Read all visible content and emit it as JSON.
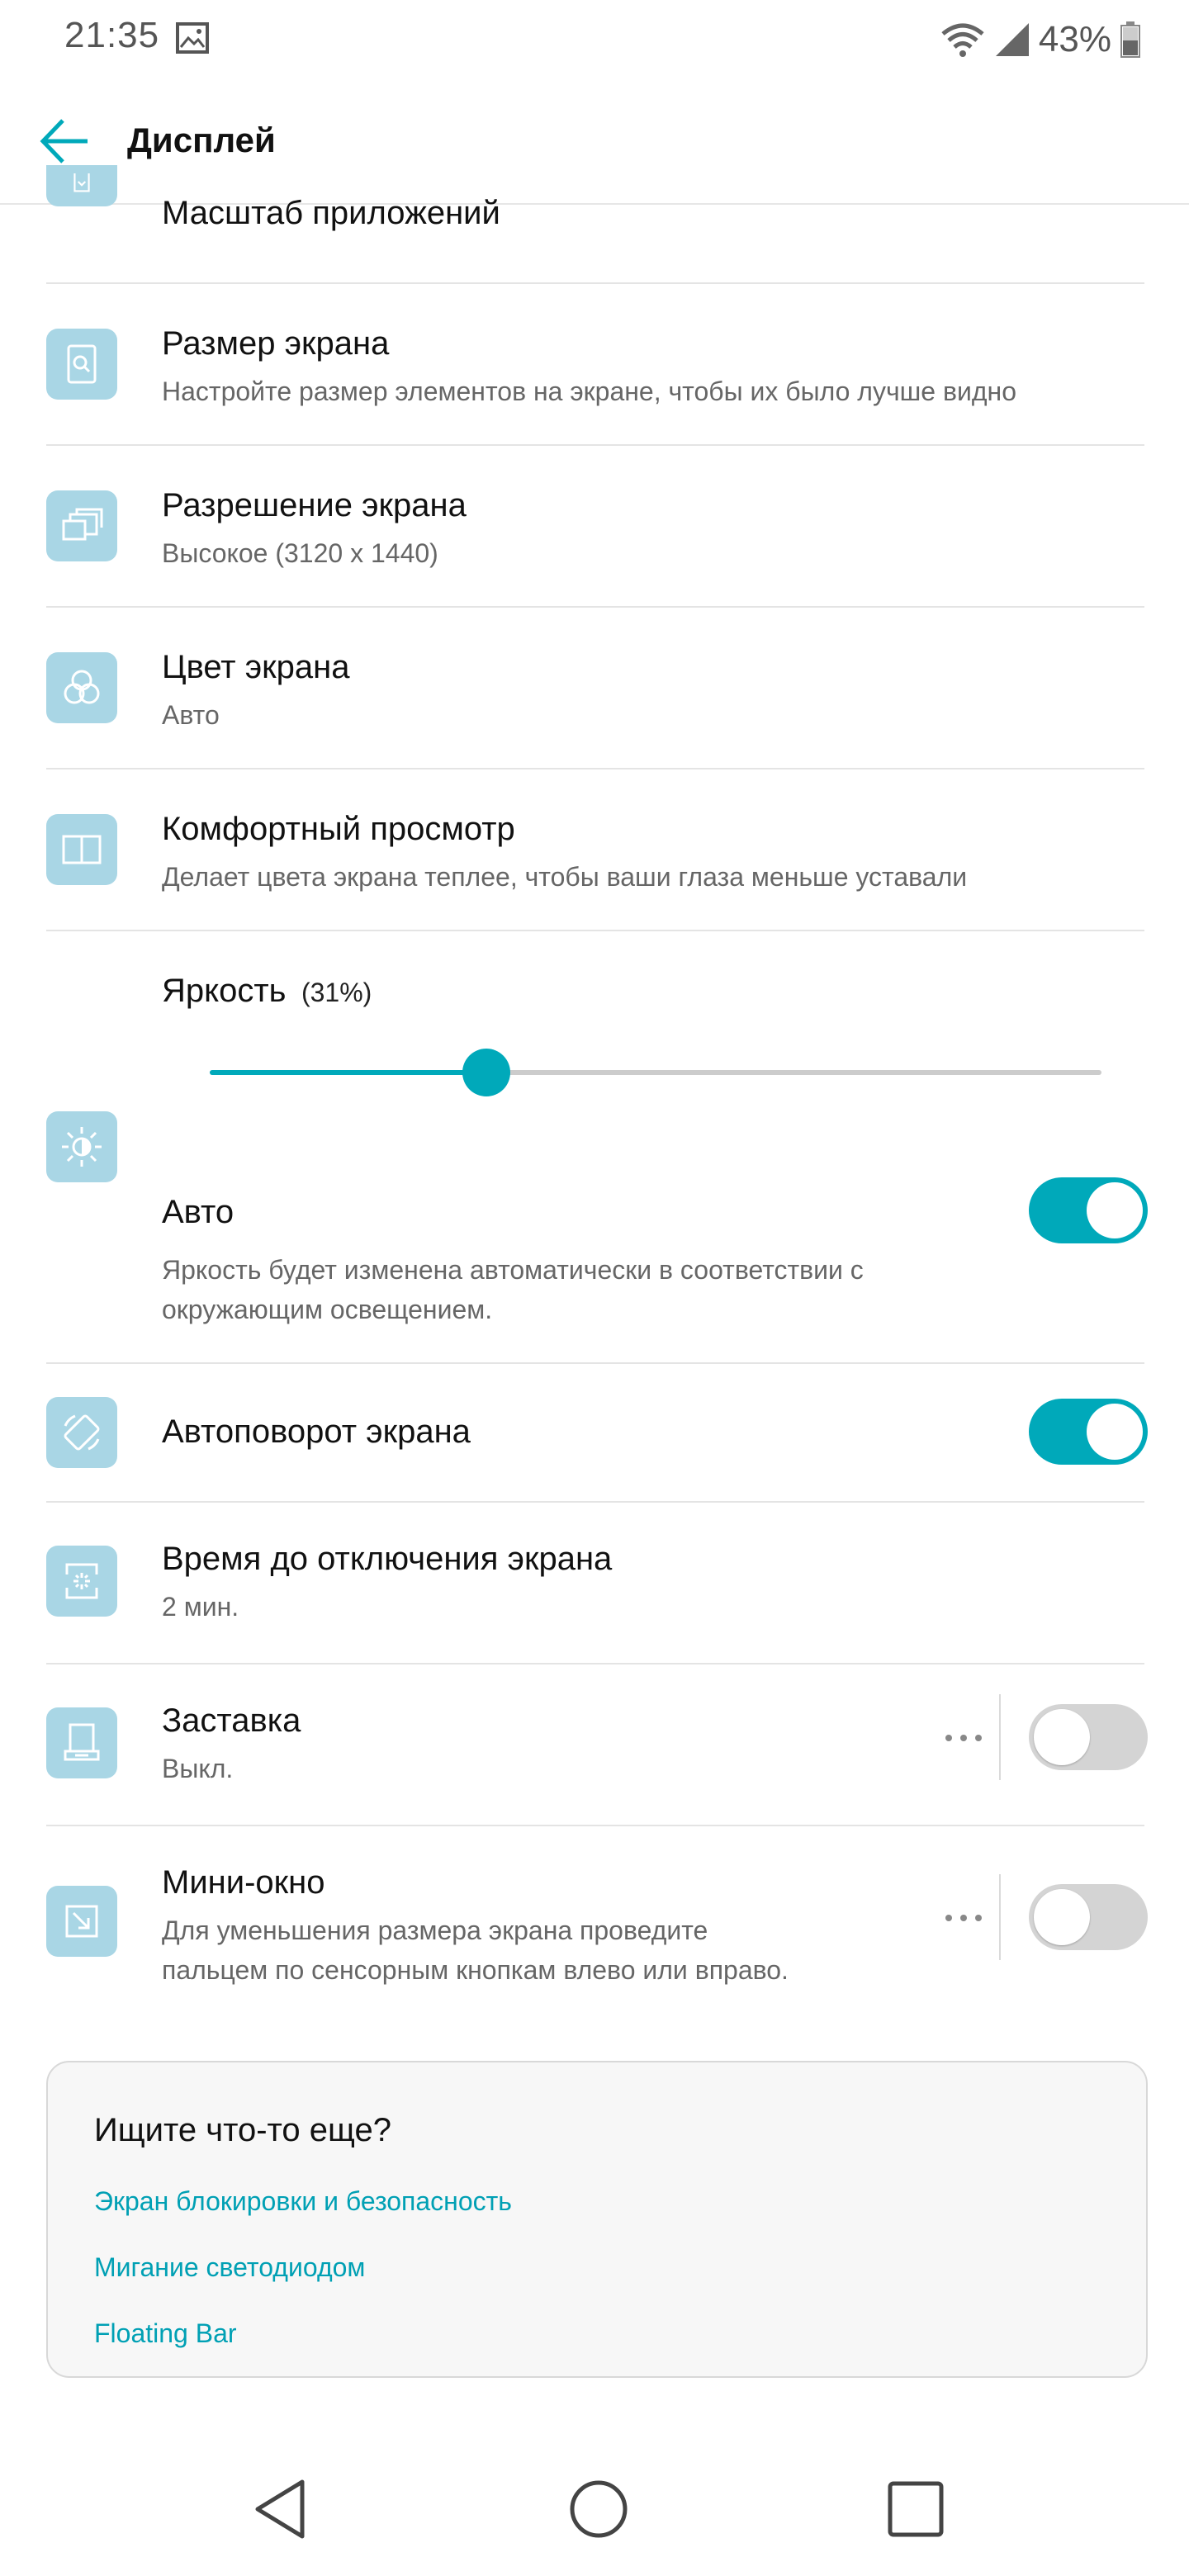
{
  "status_bar": {
    "time": "21:35",
    "battery": "43%"
  },
  "app_bar": {
    "title": "Дисплей"
  },
  "items": {
    "app_scale": {
      "title": "Масштаб приложений",
      "icon": "app-scale-icon"
    },
    "screen_size": {
      "title": "Размер экрана",
      "subtitle": "Настройте размер элементов на экране, чтобы их было лучше видно",
      "icon": "screen-size-icon"
    },
    "resolution": {
      "title": "Разрешение экрана",
      "subtitle": "Высокое (3120 x 1440)",
      "icon": "resolution-icon"
    },
    "color": {
      "title": "Цвет экрана",
      "subtitle": "Авто",
      "icon": "color-circles-icon"
    },
    "comfort": {
      "title": "Комфортный просмотр",
      "subtitle": "Делает цвета экрана теплее, чтобы ваши глаза меньше уставали",
      "icon": "book-icon"
    },
    "brightness": {
      "title": "Яркость",
      "value_label": "(31%)",
      "value": 0.31,
      "icon": "brightness-icon",
      "auto_title": "Авто",
      "auto_on": true,
      "auto_desc_1": "Яркость будет изменена автоматически в соответствии с",
      "auto_desc_2": "окружающим освещением."
    },
    "autorotate": {
      "title": "Автоповорот экрана",
      "on": true,
      "icon": "rotate-icon"
    },
    "timeout": {
      "title": "Время до отключения экрана",
      "subtitle": "2 мин.",
      "icon": "timeout-icon"
    },
    "screensaver": {
      "title": "Заставка",
      "subtitle": "Выкл.",
      "on": false,
      "icon": "screensaver-icon"
    },
    "mini_window": {
      "title": "Мини-окно",
      "subtitle_1": "Для уменьшения размера экрана проведите",
      "subtitle_2": "пальцем по сенсорным кнопкам влево или вправо.",
      "on": false,
      "icon": "mini-window-icon"
    }
  },
  "suggestions": {
    "title": "Ищите что-то еще?",
    "links": [
      "Экран блокировки и безопасность",
      "Мигание светодиодом",
      "Floating Bar"
    ]
  },
  "colors": {
    "accent": "#00a9ba",
    "icon_bg": "#a9d6e5",
    "link": "#00a0b4"
  }
}
